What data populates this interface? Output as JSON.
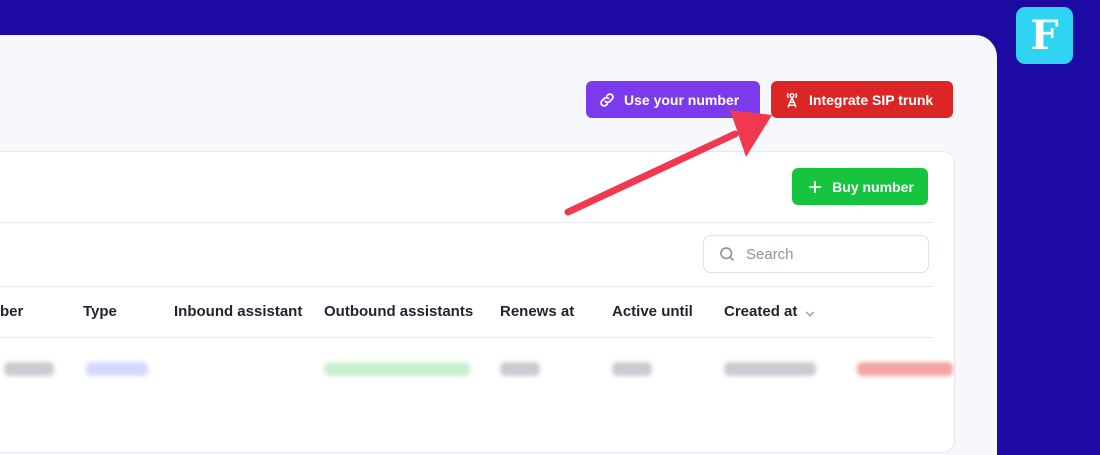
{
  "header": {
    "use_number_label": "Use your number",
    "integrate_sip_label": "Integrate SIP trunk"
  },
  "toolbar": {
    "buy_number_label": "Buy number"
  },
  "search": {
    "placeholder": "Search"
  },
  "table": {
    "columns": [
      "ber",
      "Type",
      "Inbound assistant",
      "Outbound assistants",
      "Renews at",
      "Active until",
      "Created at"
    ]
  },
  "logo": {
    "letter": "F"
  },
  "colors": {
    "background": "#1d0aa3",
    "use_number_button": "#7c3aed",
    "integrate_sip_button": "#dc2626",
    "buy_number_button": "#16c43f",
    "arrow": "#f0394f"
  },
  "icons": {
    "use_number": "link-icon",
    "integrate_sip": "antenna-tower-icon",
    "buy_number": "plus-icon",
    "search": "search-icon",
    "sort": "chevron-down-icon"
  }
}
